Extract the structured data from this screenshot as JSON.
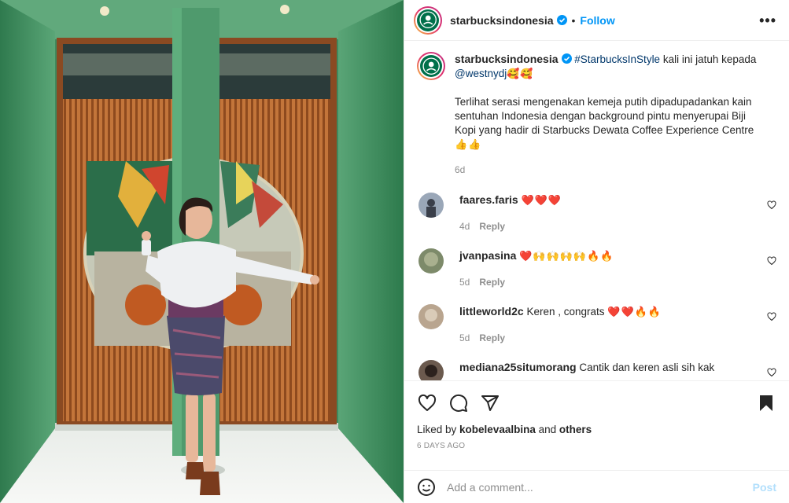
{
  "post": {
    "username": "starbucksindonesia",
    "follow_label": "Follow",
    "dot": "•",
    "more_label": "•••"
  },
  "caption": {
    "username": "starbucksindonesia",
    "hashtag": "#StarbucksInStyle",
    "text1": " kali ini jatuh kepada ",
    "mention": "@westnydj",
    "emoji1": "🥰🥰",
    "text2": "Terlihat serasi mengenakan kemeja putih dipadupadankan kain sentuhan Indonesia dengan background pintu menyerupai Biji Kopi yang hadir di Starbucks Dewata Coffee Experience Centre",
    "emoji2": "👍👍",
    "time": "6d"
  },
  "comments": [
    {
      "username": "faares.faris",
      "text": "",
      "emoji": "❤️❤️❤️",
      "time": "4d",
      "reply": "Reply",
      "avatar_color": "#9aa7b8"
    },
    {
      "username": "jvanpasina",
      "text": "",
      "emoji": "❤️🙌🙌🙌🙌🔥🔥",
      "time": "5d",
      "reply": "Reply",
      "avatar_color": "#7d8a6a"
    },
    {
      "username": "littleworld2c",
      "text": "Keren , congrats ",
      "emoji": "❤️❤️🔥🔥",
      "time": "5d",
      "reply": "Reply",
      "avatar_color": "#b9a58f"
    },
    {
      "username": "mediana25situmorang",
      "text": "Cantik dan keren asli sih kak",
      "emoji": "",
      "time": "",
      "reply": "",
      "avatar_color": "#6b5a4e"
    }
  ],
  "actions": {
    "liked_by_prefix": "Liked by ",
    "liked_by_user": "kobelevaalbina",
    "liked_by_and": " and ",
    "liked_by_others": "others",
    "posted_ago": "6 DAYS AGO"
  },
  "add_comment": {
    "placeholder": "Add a comment...",
    "post_label": "Post"
  },
  "colors": {
    "accent": "#0095f6",
    "tag": "#00376b",
    "starbucks_green": "#00704a",
    "wall_green": "#3f8a5e",
    "door_wood": "#b5652c"
  },
  "icons": [
    "verified-icon",
    "more-icon",
    "heart-icon",
    "comment-icon",
    "share-icon",
    "bookmark-icon",
    "emoji-icon"
  ]
}
